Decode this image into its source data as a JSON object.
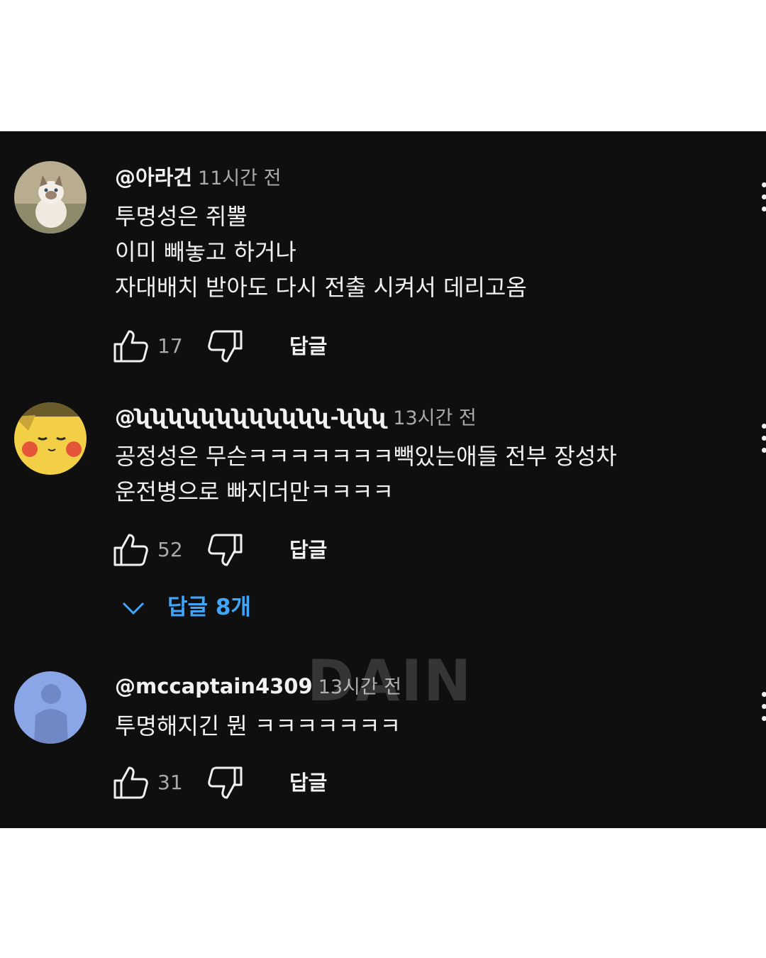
{
  "comments": [
    {
      "author": "@아라건",
      "time": "11시간 전",
      "lines": [
        "투명성은 쥐뿔",
        "이미 빼놓고 하거나",
        "자대배치 받아도 다시 전출 시켜서 데리고옴"
      ],
      "likes": "17",
      "reply_label": "답글",
      "avatar_icon": "cat-avatar"
    },
    {
      "author": "@ʯʯʯʯʯʯʯʯʯʯʯʯ-ʯʯʯ",
      "time": "13시간 전",
      "lines": [
        "공정성은 무슨ㅋㅋㅋㅋㅋㅋㅋ빽있는애들 전부 장성차",
        "운전병으로 빠지더만ㅋㅋㅋㅋ"
      ],
      "likes": "52",
      "reply_label": "답글",
      "avatar_icon": "pikachu-avatar"
    },
    {
      "author": "@mccaptain4309",
      "time": "13시간 전",
      "lines": [
        "투명해지긴 뭔 ㅋㅋㅋㅋㅋㅋㅋ"
      ],
      "likes": "31",
      "reply_label": "답글",
      "avatar_icon": "person-silhouette-avatar"
    }
  ],
  "replies_toggle": {
    "label": "답글 8개"
  },
  "watermark": "DAIN",
  "colors": {
    "background": "#0f0f0f",
    "text": "#f1f1f1",
    "secondary_text": "#aaaaaa",
    "link": "#3ea6ff"
  }
}
